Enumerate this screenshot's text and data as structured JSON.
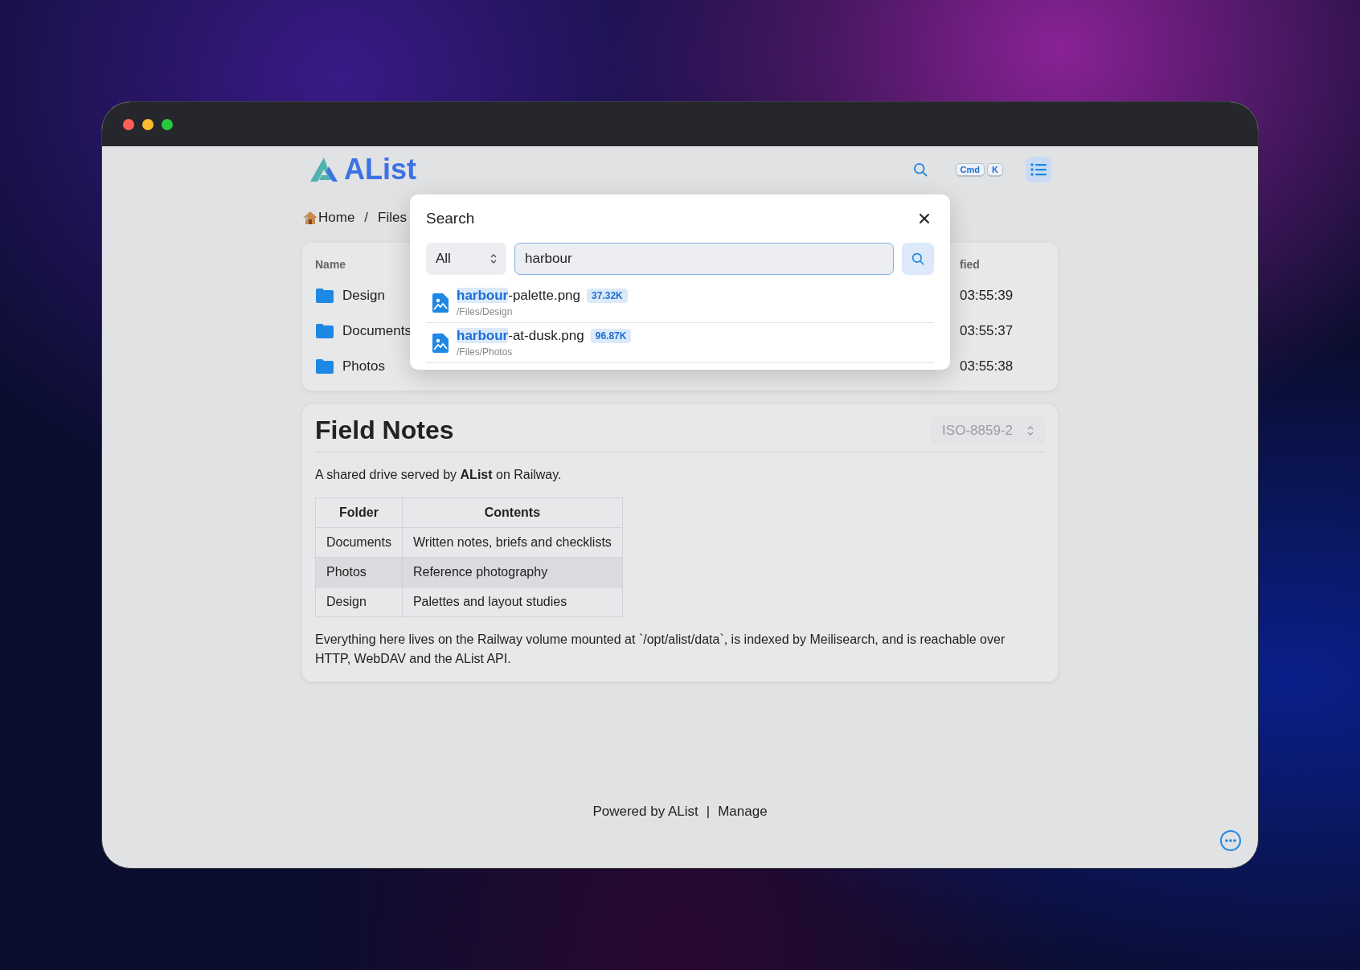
{
  "header": {
    "logo": "AList",
    "shortcut": [
      "Cmd",
      "K"
    ]
  },
  "breadcrumb": {
    "items": [
      "Home",
      "Files"
    ],
    "separator": "/"
  },
  "file_list": {
    "columns": [
      "Name",
      "fied"
    ],
    "rows": [
      {
        "name": "Design",
        "modified": "03:55:39"
      },
      {
        "name": "Documents",
        "modified": "03:55:37"
      },
      {
        "name": "Photos",
        "modified": "03:55:38"
      }
    ]
  },
  "readme": {
    "title": "Field Notes",
    "encoding": {
      "value": "ISO-8859-2",
      "disabled": true
    },
    "intro": "A shared drive served by **AList** on Railway.",
    "table": {
      "columns": [
        "Folder",
        "Contents"
      ],
      "rows": [
        {
          "cells": [
            "Documents",
            "Written notes, briefs and checklists"
          ],
          "highlighted": false
        },
        {
          "cells": [
            "Photos",
            "Reference photography"
          ],
          "highlighted": true
        },
        {
          "cells": [
            "Design",
            "Palettes and layout studies"
          ],
          "highlighted": false
        }
      ]
    },
    "outro": "Everything here lives on the Railway volume mounted at `/opt/alist/data`, is indexed by Meilisearch, and is reachable over HTTP, WebDAV and the AList API."
  },
  "footer": {
    "links": [
      "Powered by AList",
      "Manage"
    ],
    "separator": "|"
  },
  "search_dialog": {
    "title": "Search",
    "scope": "All",
    "query": "harbour",
    "results": [
      {
        "match": "harbour",
        "rest": "-palette.png",
        "size": "37.32K",
        "path": "/Files/Design"
      },
      {
        "match": "harbour",
        "rest": "-at-dusk.png",
        "size": "96.87K",
        "path": "/Files/Photos"
      }
    ]
  }
}
